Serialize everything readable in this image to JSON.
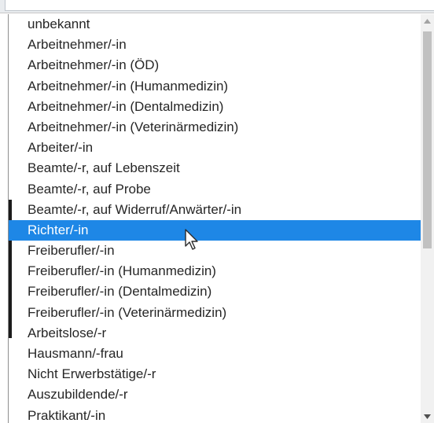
{
  "dropdown": {
    "options": [
      "unbekannt",
      "Arbeitnehmer/-in",
      "Arbeitnehmer/-in (ÖD)",
      "Arbeitnehmer/-in (Humanmedizin)",
      "Arbeitnehmer/-in (Dentalmedizin)",
      "Arbeitnehmer/-in (Veterinärmedizin)",
      "Arbeiter/-in",
      "Beamte/-r, auf Lebenszeit",
      "Beamte/-r, auf Probe",
      "Beamte/-r, auf Widerruf/Anwärter/-in",
      "Richter/-in",
      "Freiberufler/-in",
      "Freiberufler/-in (Humanmedizin)",
      "Freiberufler/-in (Dentalmedizin)",
      "Freiberufler/-in (Veterinärmedizin)",
      "Arbeitslose/-r",
      "Hausmann/-frau",
      "Nicht Erwerbstätige/-r",
      "Auszubildende/-r",
      "Praktikant/-in"
    ],
    "highlighted_option": "Richter/-in",
    "highlight_color": "#1e87e6"
  },
  "icons": {
    "scroll_up": "triangle-up-icon",
    "scroll_down": "triangle-down-icon",
    "cursor": "pointer-cursor-icon"
  }
}
